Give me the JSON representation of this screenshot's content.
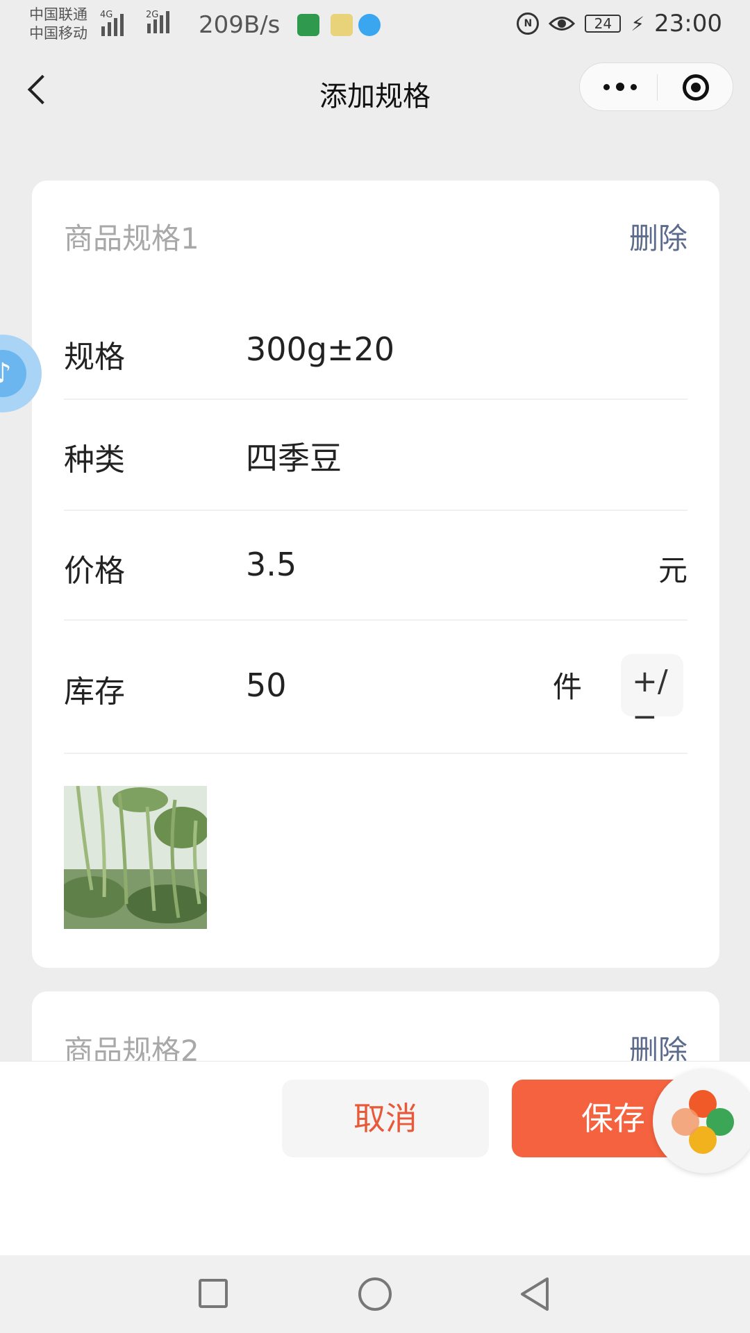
{
  "status_bar": {
    "carrier_1": "中国联通",
    "carrier_2": "中国移动",
    "network_1": "4G",
    "network_2": "2G",
    "net_speed": "209B/s",
    "nfc_badge": "N",
    "battery": "24",
    "time": "23:00"
  },
  "nav": {
    "title": "添加规格"
  },
  "specs": [
    {
      "title": "商品规格1",
      "delete_label": "删除",
      "fields": {
        "spec_label": "规格",
        "spec_value": "300g±20",
        "type_label": "种类",
        "type_value": "四季豆",
        "price_label": "价格",
        "price_value": "3.5",
        "price_unit": "元",
        "stock_label": "库存",
        "stock_value": "50",
        "stock_unit": "件",
        "stock_toggle": "+/−"
      }
    },
    {
      "title": "商品规格2",
      "delete_label": "删除"
    }
  ],
  "actions": {
    "cancel_label": "取消",
    "save_label": "保存"
  },
  "colors": {
    "accent_red": "#f5623f",
    "cancel_text": "#e8593a",
    "delete_link": "#5c6b8c"
  },
  "icons": [
    "back-icon",
    "more-icon",
    "target-icon",
    "music-icon",
    "square-icon",
    "home-circle-icon",
    "triangle-back-icon"
  ]
}
